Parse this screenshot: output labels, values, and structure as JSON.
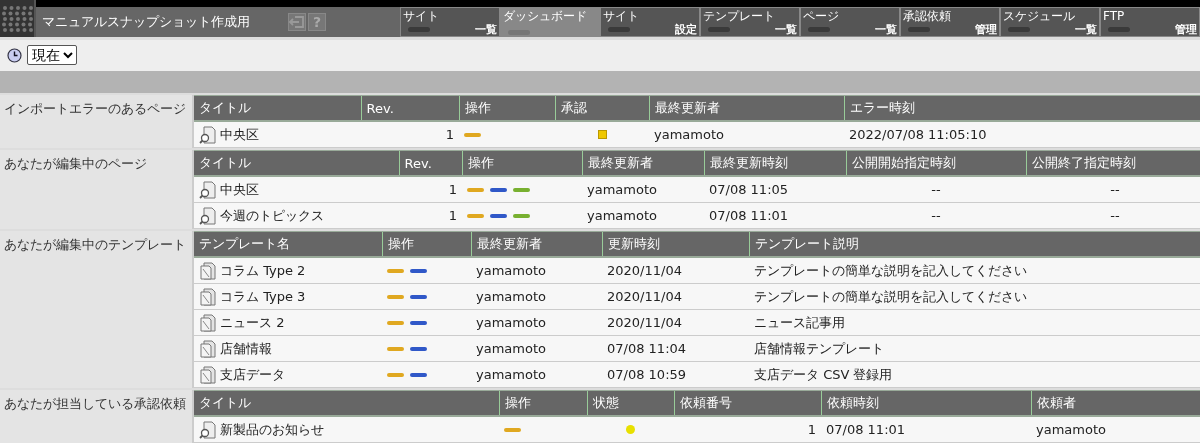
{
  "app_title": "マニュアルスナップショット作成用",
  "help_button": "?",
  "nav_tabs": [
    {
      "top": "サイト",
      "bottom": "一覧",
      "selected": false
    },
    {
      "top": "ダッシュボード",
      "selected": true
    },
    {
      "top": "サイト",
      "bottom": "設定",
      "selected": false
    },
    {
      "top": "テンプレート",
      "bottom": "一覧",
      "selected": false
    },
    {
      "top": "ページ",
      "bottom": "一覧",
      "selected": false
    },
    {
      "top": "承認依頼",
      "bottom": "管理",
      "selected": false
    },
    {
      "top": "スケジュール",
      "bottom": "一覧",
      "selected": false
    },
    {
      "top": "FTP",
      "bottom": "管理",
      "selected": false
    }
  ],
  "time_select": {
    "value": "現在"
  },
  "sections": [
    {
      "label": "インポートエラーのあるページ",
      "columns": [
        "タイトル",
        "Rev.",
        "操作",
        "承認",
        "最終更新者",
        "エラー時刻"
      ],
      "rows": [
        {
          "cells": [
            {
              "kind": "page",
              "text": "中央区"
            },
            {
              "kind": "num",
              "text": "1"
            },
            {
              "kind": "ops",
              "ops": [
                {
                  "color": "#e0a820"
                }
              ]
            },
            {
              "kind": "square",
              "color": "#f0c800"
            },
            {
              "kind": "text",
              "text": "yamamoto"
            },
            {
              "kind": "text",
              "text": "2022/07/08 11:05:10"
            }
          ]
        }
      ]
    },
    {
      "label": "あなたが編集中のページ",
      "columns": [
        "タイトル",
        "Rev.",
        "操作",
        "最終更新者",
        "最終更新時刻",
        "公開開始指定時刻",
        "公開終了指定時刻"
      ],
      "rows": [
        {
          "cells": [
            {
              "kind": "page",
              "text": "中央区"
            },
            {
              "kind": "num",
              "text": "1"
            },
            {
              "kind": "ops",
              "ops": [
                {
                  "color": "#e0a820"
                },
                {
                  "color": "#3058c8"
                },
                {
                  "color": "#78b030"
                }
              ]
            },
            {
              "kind": "text",
              "text": "yamamoto"
            },
            {
              "kind": "text",
              "text": "07/08 11:05"
            },
            {
              "kind": "center",
              "text": "--"
            },
            {
              "kind": "center",
              "text": "--"
            }
          ]
        },
        {
          "cells": [
            {
              "kind": "page",
              "text": "今週のトピックス"
            },
            {
              "kind": "num",
              "text": "1"
            },
            {
              "kind": "ops",
              "ops": [
                {
                  "color": "#e0a820"
                },
                {
                  "color": "#3058c8"
                },
                {
                  "color": "#78b030"
                }
              ]
            },
            {
              "kind": "text",
              "text": "yamamoto"
            },
            {
              "kind": "text",
              "text": "07/08 11:01"
            },
            {
              "kind": "center",
              "text": "--"
            },
            {
              "kind": "center",
              "text": "--"
            }
          ]
        }
      ]
    },
    {
      "label": "あなたが編集中のテンプレート",
      "columns": [
        "テンプレート名",
        "操作",
        "最終更新者",
        "更新時刻",
        "テンプレート説明"
      ],
      "rows": [
        {
          "cells": [
            {
              "kind": "template",
              "text": "コラム Type 2"
            },
            {
              "kind": "ops",
              "ops": [
                {
                  "color": "#e0a820"
                },
                {
                  "color": "#3058c8"
                }
              ]
            },
            {
              "kind": "text",
              "text": "yamamoto"
            },
            {
              "kind": "text",
              "text": "2020/11/04"
            },
            {
              "kind": "text",
              "text": "テンプレートの簡単な説明を記入してください"
            }
          ]
        },
        {
          "cells": [
            {
              "kind": "template",
              "text": "コラム Type 3"
            },
            {
              "kind": "ops",
              "ops": [
                {
                  "color": "#e0a820"
                },
                {
                  "color": "#3058c8"
                }
              ]
            },
            {
              "kind": "text",
              "text": "yamamoto"
            },
            {
              "kind": "text",
              "text": "2020/11/04"
            },
            {
              "kind": "text",
              "text": "テンプレートの簡単な説明を記入してください"
            }
          ]
        },
        {
          "cells": [
            {
              "kind": "template",
              "text": "ニュース 2"
            },
            {
              "kind": "ops",
              "ops": [
                {
                  "color": "#e0a820"
                },
                {
                  "color": "#3058c8"
                }
              ]
            },
            {
              "kind": "text",
              "text": "yamamoto"
            },
            {
              "kind": "text",
              "text": "2020/11/04"
            },
            {
              "kind": "text",
              "text": "ニュース記事用"
            }
          ]
        },
        {
          "cells": [
            {
              "kind": "template",
              "text": "店舗情報"
            },
            {
              "kind": "ops",
              "ops": [
                {
                  "color": "#e0a820"
                },
                {
                  "color": "#3058c8"
                }
              ]
            },
            {
              "kind": "text",
              "text": "yamamoto"
            },
            {
              "kind": "text",
              "text": "07/08 11:04"
            },
            {
              "kind": "text",
              "text": "店舗情報テンプレート"
            }
          ]
        },
        {
          "cells": [
            {
              "kind": "template",
              "text": "支店データ"
            },
            {
              "kind": "ops",
              "ops": [
                {
                  "color": "#e0a820"
                },
                {
                  "color": "#3058c8"
                }
              ]
            },
            {
              "kind": "text",
              "text": "yamamoto"
            },
            {
              "kind": "text",
              "text": "07/08 10:59"
            },
            {
              "kind": "text",
              "text": "支店データ CSV 登録用"
            }
          ]
        }
      ]
    },
    {
      "label": "あなたが担当している承認依頼",
      "columns": [
        "タイトル",
        "操作",
        "状態",
        "依頼番号",
        "依頼時刻",
        "依頼者"
      ],
      "rows": [
        {
          "cells": [
            {
              "kind": "page",
              "text": "新製品のお知らせ"
            },
            {
              "kind": "ops",
              "ops": [
                {
                  "color": "#e0a820"
                }
              ]
            },
            {
              "kind": "dot",
              "color": "#e8e000"
            },
            {
              "kind": "num",
              "text": "1"
            },
            {
              "kind": "text",
              "text": "07/08 11:01"
            },
            {
              "kind": "text",
              "text": "yamamoto"
            }
          ]
        }
      ]
    }
  ]
}
